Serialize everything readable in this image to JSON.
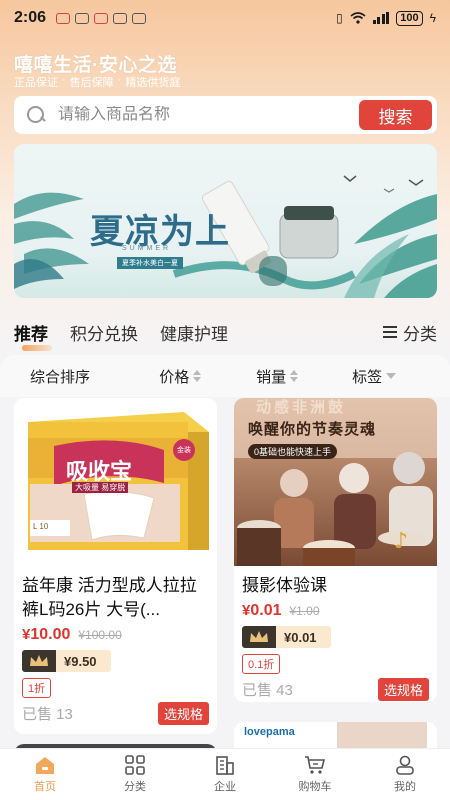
{
  "status_bar": {
    "time": "2:06",
    "battery": "100"
  },
  "brand": {
    "title": "嘻嘻生活·安心之选",
    "tags": [
      "正品保证",
      "售后保障",
      "精选供货庭"
    ]
  },
  "search": {
    "placeholder": "请输入商品名称",
    "button_label": "搜索"
  },
  "banner": {
    "title": "夏凉为上",
    "subtitle": "SUMMER",
    "tag": "夏季补水美白一夏"
  },
  "category_tabs": {
    "items": [
      "推荐",
      "积分兑换",
      "健康护理"
    ],
    "active_index": 0,
    "classify_label": "分类"
  },
  "sort_bar": {
    "items": [
      "综合排序",
      "价格",
      "销量",
      "标签"
    ]
  },
  "products": [
    {
      "name": "益年康 活力型成人拉拉裤L码26片 大号(...",
      "price_symbol": "¥",
      "price": "10.00",
      "original_price": "¥100.00",
      "member_price": "¥9.50",
      "discount": "1折",
      "sold": "已售 13",
      "spec_button": "选规格",
      "image_text": {
        "brand": "吸收宝",
        "line1": "大吸量 易穿脱",
        "badge": "金装",
        "size": "L 10"
      }
    },
    {
      "name": "摄影体验课",
      "price_symbol": "¥",
      "price": "0.01",
      "original_price": "¥1.00",
      "member_price": "¥0.01",
      "discount": "0.1折",
      "sold": "已售 43",
      "spec_button": "选规格",
      "image_text": {
        "top": "动感非洲鼓",
        "line1": "唤醒你的节奏灵魂",
        "line2": "0基础也能快速上手"
      }
    }
  ],
  "peek": {
    "right_logo": "lovepama"
  },
  "tab_bar": {
    "items": [
      {
        "label": "首页",
        "icon": "home-icon"
      },
      {
        "label": "分类",
        "icon": "grid-icon"
      },
      {
        "label": "企业",
        "icon": "building-icon"
      },
      {
        "label": "购物车",
        "icon": "cart-icon"
      },
      {
        "label": "我的",
        "icon": "user-icon"
      }
    ],
    "active_index": 0
  },
  "colors": {
    "accent_red": "#e0443b",
    "tab_active": "#e99c4f",
    "header_gradient_top": "#f6c79e"
  }
}
